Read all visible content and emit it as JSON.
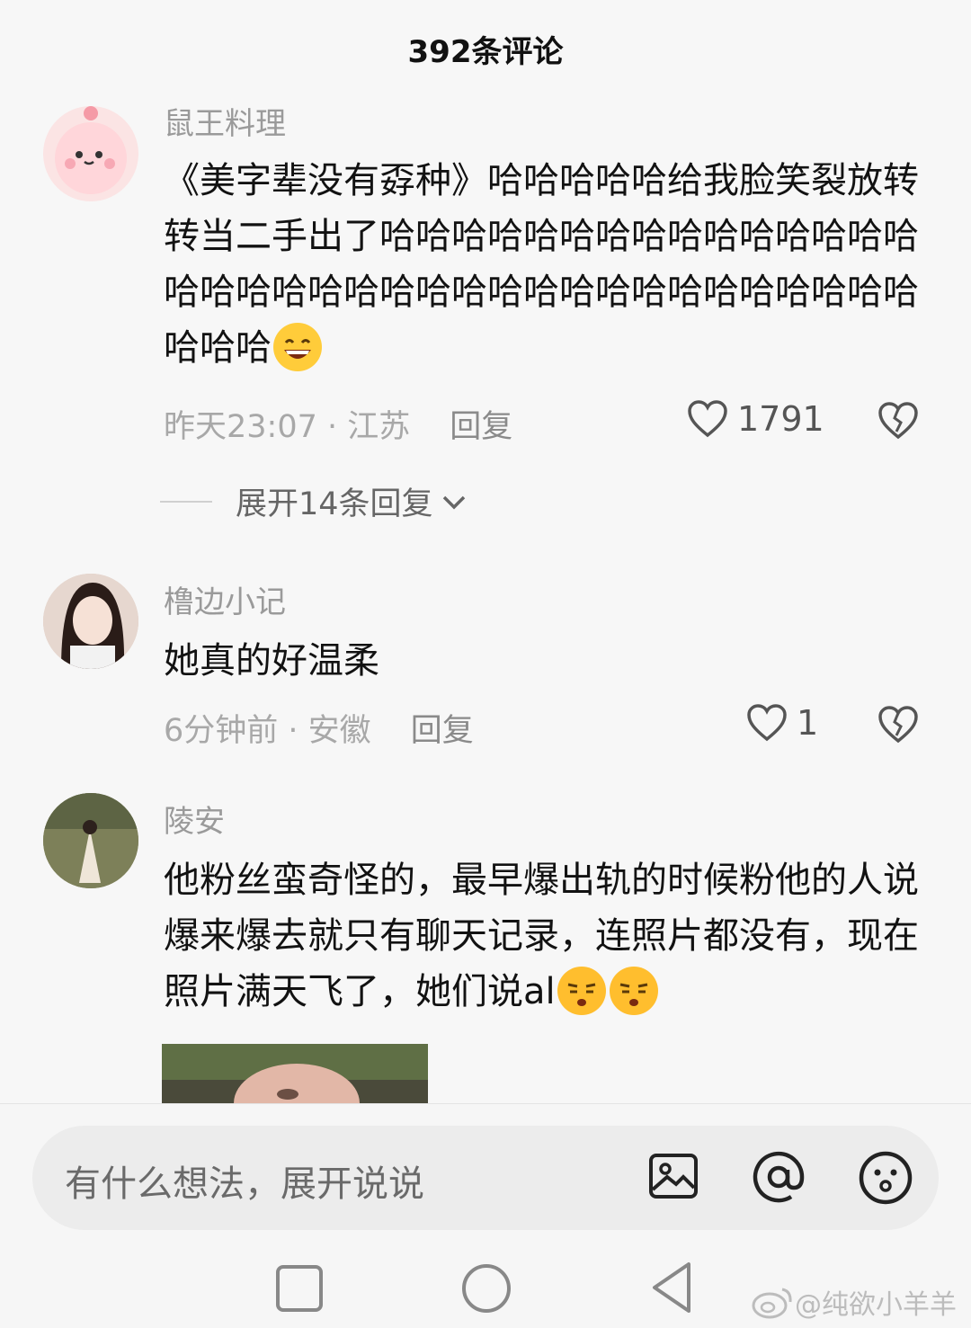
{
  "header": {
    "title": "392条评论"
  },
  "comments": [
    {
      "username": "鼠王料理",
      "text": "《美字辈没有孬种》哈哈哈哈哈给我脸笑裂放转转当二手出了哈哈哈哈哈哈哈哈哈哈哈哈哈哈哈哈哈哈哈哈哈哈哈哈哈哈哈哈哈哈哈哈哈哈哈哈哈哈哈",
      "emoji": "grinning-emoji",
      "time": "昨天23:07",
      "location": "江苏",
      "reply_label": "回复",
      "likes": "1791",
      "expand_label": "展开14条回复"
    },
    {
      "username": "橹边小记",
      "text": "她真的好温柔",
      "time": "6分钟前",
      "location": "安徽",
      "reply_label": "回复",
      "likes": "1"
    },
    {
      "username": "陵安",
      "text": "他粉丝蛮奇怪的，最早爆出轨的时候粉他的人说爆来爆去就只有聊天记录，连照片都没有，现在照片满天飞了，她们说al",
      "emojis": [
        "smug-emoji",
        "smug-emoji"
      ]
    }
  ],
  "input": {
    "placeholder": "有什么想法，展开说说"
  },
  "icons": [
    "image-icon",
    "at-icon",
    "emoji-icon"
  ],
  "nav": [
    "square-nav-icon",
    "circle-nav-icon",
    "back-triangle-icon"
  ],
  "watermark": "@纯欲小羊羊"
}
